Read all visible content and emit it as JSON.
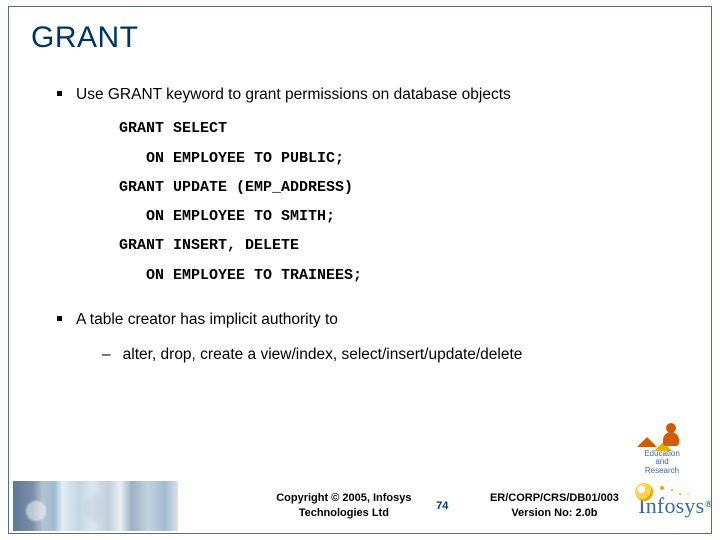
{
  "title": "GRANT",
  "bullet1": "Use GRANT keyword to grant permissions on database objects",
  "code": "GRANT SELECT\n   ON EMPLOYEE TO PUBLIC;\nGRANT UPDATE (EMP_ADDRESS)\n   ON EMPLOYEE TO SMITH;\nGRANT INSERT, DELETE\n   ON EMPLOYEE TO TRAINEES;",
  "bullet2": "A table creator has implicit authority to",
  "sub1": "alter, drop, create a view/index, select/insert/update/delete",
  "footer": {
    "copyright_line1": "Copyright © 2005, Infosys",
    "copyright_line2": "Technologies Ltd",
    "page": "74",
    "docref_line1": "ER/CORP/CRS/DB01/003",
    "docref_line2": "Version No: 2.0b"
  },
  "badge": {
    "line1": "Education",
    "line2": "and",
    "line3": "Research"
  },
  "logo": "Infosys"
}
